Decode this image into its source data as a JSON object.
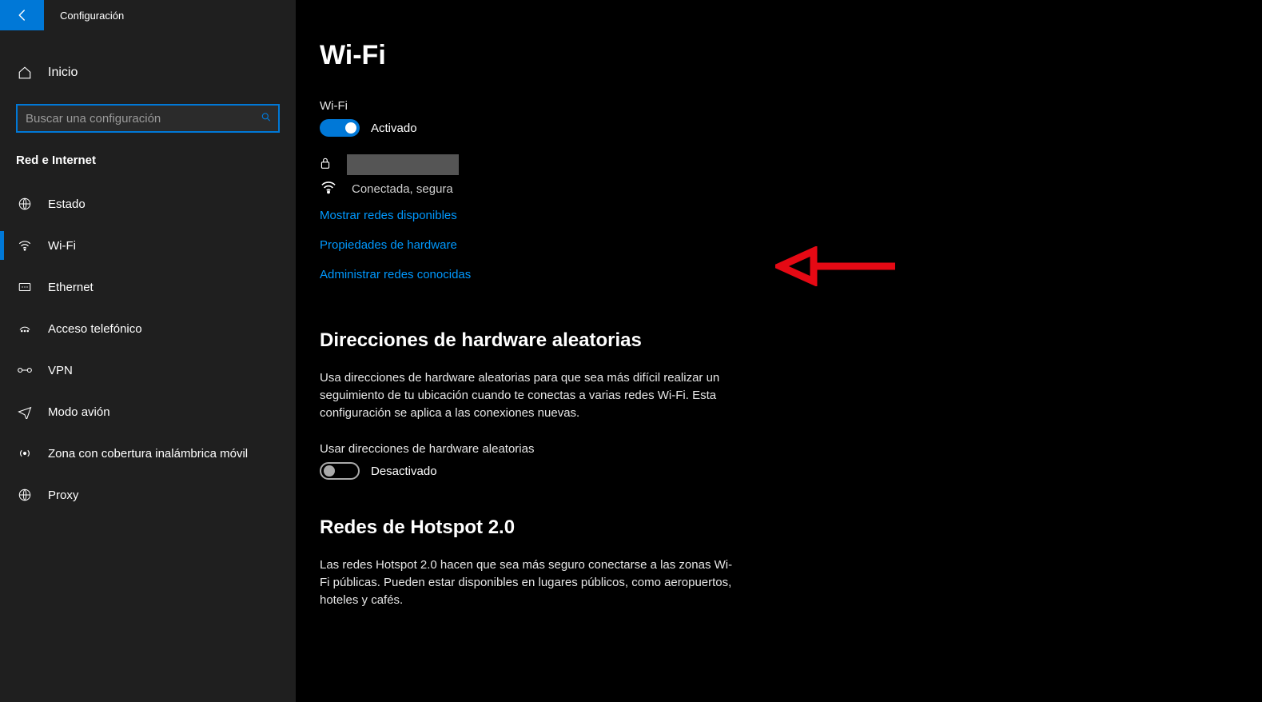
{
  "header": {
    "app_title": "Configuración"
  },
  "sidebar": {
    "home_label": "Inicio",
    "search_placeholder": "Buscar una configuración",
    "section_heading": "Red e Internet",
    "items": [
      {
        "label": "Estado",
        "icon": "status-icon",
        "active": false
      },
      {
        "label": "Wi-Fi",
        "icon": "wifi-icon",
        "active": true
      },
      {
        "label": "Ethernet",
        "icon": "ethernet-icon",
        "active": false
      },
      {
        "label": "Acceso telefónico",
        "icon": "dialup-icon",
        "active": false
      },
      {
        "label": "VPN",
        "icon": "vpn-icon",
        "active": false
      },
      {
        "label": "Modo avión",
        "icon": "airplane-icon",
        "active": false
      },
      {
        "label": "Zona con cobertura inalámbrica móvil",
        "icon": "hotspot-icon",
        "active": false
      },
      {
        "label": "Proxy",
        "icon": "proxy-icon",
        "active": false
      }
    ]
  },
  "main": {
    "page_title": "Wi-Fi",
    "wifi_toggle_heading": "Wi-Fi",
    "wifi_toggle_state_label": "Activado",
    "network_status": "Conectada, segura",
    "links": {
      "show_networks": "Mostrar redes disponibles",
      "hw_properties": "Propiedades de hardware",
      "manage_known": "Administrar redes conocidas"
    },
    "random_hw": {
      "title": "Direcciones de hardware aleatorias",
      "desc": "Usa direcciones de hardware aleatorias para que sea más difícil realizar un seguimiento de tu ubicación cuando te conectas a varias redes Wi-Fi. Esta configuración se aplica a las conexiones nuevas.",
      "toggle_heading": "Usar direcciones de hardware aleatorias",
      "toggle_state_label": "Desactivado"
    },
    "hotspot2": {
      "title": "Redes de Hotspot 2.0",
      "desc": "Las redes Hotspot 2.0 hacen que sea más seguro conectarse a las zonas Wi-Fi públicas. Pueden estar disponibles en lugares públicos, como aeropuertos, hoteles y cafés."
    }
  },
  "colors": {
    "accent": "#0078d7",
    "link": "#0099ff"
  }
}
